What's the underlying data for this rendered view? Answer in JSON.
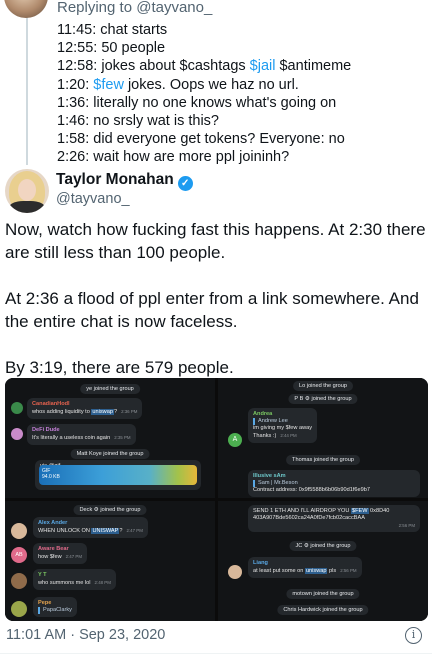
{
  "reply": {
    "prefix": "Replying to ",
    "handle": "@tayvano_",
    "lines": [
      "11:45: chat starts",
      "12:55: 50 people",
      "12:58: jokes about $cashtags ",
      "$jail",
      " $antimeme",
      "1:20: ",
      "$few",
      " jokes. Oops we haz no url.",
      "1:36: literally no one knows what's going on",
      "1:46: no srsly wat is this?",
      "1:58: did everyone get tokens? Everyone: no",
      "2:26: wait how are more ppl joininh?"
    ]
  },
  "author": {
    "name": "Taylor Monahan",
    "handle": "@tayvano_",
    "verified_symbol": "✓"
  },
  "tweet": {
    "para1": "Now, watch how fucking fast this happens. At 2:30 there are still less than 100 people.",
    "para2": "At 2:36 a flood of ppl enter from a link somewhere. And the entire chat is now faceless.",
    "para3": "By 3:19, there are 579 people."
  },
  "screens": {
    "p1": {
      "sys1": "ye joined the group",
      "m1_name": "CanadianHodl",
      "m1_pre": "whos adding liquidity to ",
      "m1_hl": "uniswap",
      "m1_post": "?",
      "m1_time": "2:36 PM",
      "m2_name": "DeFi Dude",
      "m2_text": "It's literally a useless coin again",
      "m2_time": "2:35 PM",
      "sys2": "Matt Koye joined the group",
      "via": "via @gif",
      "gif_line1": "GIF",
      "gif_line2": "94.0 KB"
    },
    "p2": {
      "sys1": "Lo joined the group",
      "sys2": "P B ⚙ joined the group",
      "m1_name": "Andrea",
      "m1_quote": "Andrew Lee",
      "m1_text1": "im giving my $few away",
      "m1_text2": "Thanks :)",
      "m1_time": "2:44 PM",
      "av_letter": "A",
      "sys3": "Thomas joined the group",
      "m2_name": "Illusive sAm",
      "m2_quote": "Sam | Mr.Beson",
      "m2_text": "Contract address: 0x9f5588b6b06b90d1f6e9b7"
    },
    "p3": {
      "sys1": "Deck ⚙ joined the group",
      "m1_name": "Alex Ander",
      "m1_pre": "WHEN UNLOCK ON ",
      "m1_hl": "UNISWAP",
      "m1_post": "?",
      "m1_time": "2:47 PM",
      "av_letters": "AB",
      "m2_name": "Aware Bear",
      "m2_text": "how $few",
      "m2_time": "2:47 PM",
      "m3_name": "Y T",
      "m3_text": "who summons me lol",
      "m3_time": "2:48 PM",
      "m4_name": "Pepe",
      "m4_quote": "PapaClarky"
    },
    "p4": {
      "m1_pre": "SEND 1 ETH AND I'LL AIRDROP YOU ",
      "m1_hl": "$FEW",
      "m1_post": " 0x8D40",
      "m1_line2": "403A907Bde5602ca24A0fDe7fcb02caccBAA",
      "m1_time": "2:56 PM",
      "sys1": "JC ⚙ joined the group",
      "m2_name": "Liang",
      "m2_pre": "at least put some on ",
      "m2_hl": "uniswap",
      "m2_post": " pls",
      "m2_time": "2:56 PM",
      "sys2": "motown joined the group",
      "sys3": "Chris Hardwick joined the group"
    }
  },
  "footer": {
    "timestamp": "11:01 AM · Sep 23, 2020",
    "info_icon": "info-icon",
    "info_symbol": "i"
  },
  "colors": {
    "link": "#1d9bf0",
    "secondary_text": "#536471",
    "chat_bg": "#121416"
  }
}
